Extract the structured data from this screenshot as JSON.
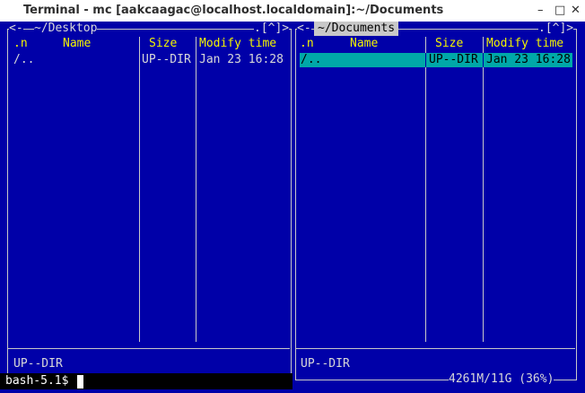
{
  "window": {
    "title": "Terminal - mc [aakcaagac@localhost.localdomain]:~/Documents",
    "controls": [
      "–",
      "□",
      "✕"
    ]
  },
  "left_panel": {
    "path": "~/Desktop",
    "left_arrows": "<-",
    "right_marker": ".[^]>",
    "columns": [
      ".n",
      "Name",
      "Size",
      "Modify time"
    ],
    "rows": [
      {
        "name": "/..",
        "size": "UP--DIR",
        "time": "Jan 23 16:28"
      }
    ],
    "status": "UP--DIR"
  },
  "right_panel": {
    "path": "~/Documents",
    "left_arrows": "<-",
    "right_marker": ".[^]>",
    "columns": [
      ".n",
      "Name",
      "Size",
      "Modify time"
    ],
    "rows": [
      {
        "name": "/..",
        "size": "UP--DIR",
        "time": "Jan 23 16:28"
      }
    ],
    "status": "UP--DIR",
    "disk_info": "4261M/11G (36%)"
  },
  "prompt": {
    "text": "bash-5.1$"
  },
  "colors": {
    "panel_bg": "#0000a8",
    "header_text": "#f4f400",
    "selection_bg": "#00a8a8",
    "frame": "#c8c8c8"
  }
}
